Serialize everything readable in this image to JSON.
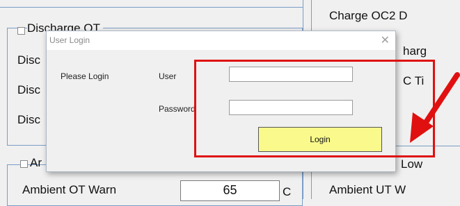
{
  "background": {
    "left_group_1": {
      "checkbox_title": "Discharge OT",
      "rows": [
        "Disc",
        "Disc",
        "Disc"
      ]
    },
    "right_group_1": {
      "title": "Charge OC2 D",
      "rows": [
        "harg",
        "C Ti"
      ]
    },
    "left_group_2": {
      "checkbox_title": "Ar",
      "row_label": "Ambient OT Warn",
      "row_value": "65",
      "row_unit": "C"
    },
    "right_group_2": {
      "title": "Low",
      "row_label": "Ambient UT W"
    }
  },
  "dialog": {
    "title": "User Login",
    "close_glyph": "✕",
    "prompt": "Please Login",
    "user_label": "User",
    "user_value": "",
    "password_label": "Password",
    "password_value": "",
    "login_label": "Login"
  },
  "annotation": {
    "highlight_color": "#e01010",
    "arrow_color": "#e01010"
  }
}
